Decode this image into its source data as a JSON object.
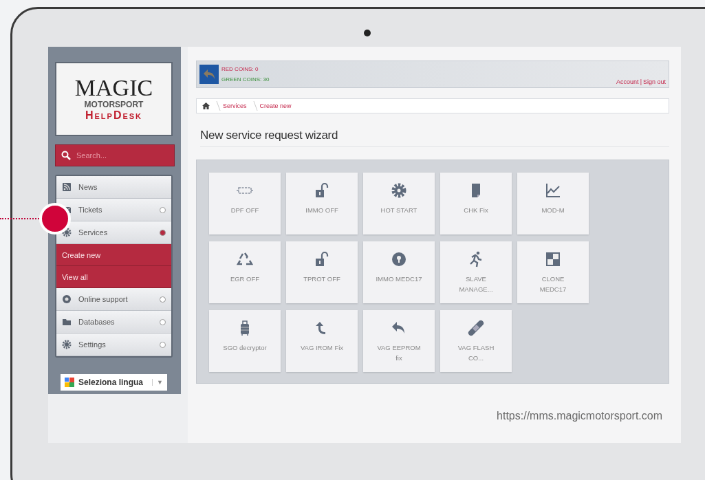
{
  "sidebar": {
    "logo": {
      "title": "MAGIC",
      "subtitle": "MOTORSPORT",
      "product": "HelpDesk"
    },
    "search": {
      "placeholder": "Search..."
    },
    "menu": [
      {
        "label": "News",
        "kind": "plain"
      },
      {
        "label": "Tickets",
        "kind": "expandable",
        "expanded": false
      },
      {
        "label": "Services",
        "kind": "expandable",
        "expanded": true,
        "children": [
          {
            "label": "Create new"
          },
          {
            "label": "View all"
          }
        ]
      },
      {
        "label": "Online support",
        "kind": "expandable",
        "expanded": false
      },
      {
        "label": "Databases",
        "kind": "expandable",
        "expanded": false
      },
      {
        "label": "Settings",
        "kind": "expandable",
        "expanded": false
      }
    ],
    "language": {
      "label": "Seleziona lingua",
      "caret": "▼"
    }
  },
  "topbar": {
    "red_coins": "RED COINS: 0",
    "green_coins": "GREEN COINS: 30",
    "account": "Account",
    "separator": "|",
    "sign_out": "Sign out"
  },
  "breadcrumb": [
    "Services",
    "Create new"
  ],
  "title": "New service request wizard",
  "tiles": [
    {
      "lines": [
        "DPF OFF"
      ]
    },
    {
      "lines": [
        "IMMO OFF"
      ]
    },
    {
      "lines": [
        "HOT START"
      ]
    },
    {
      "lines": [
        "CHK Fix"
      ]
    },
    {
      "lines": [
        "MOD-M"
      ]
    },
    {
      "lines": [
        "EGR OFF"
      ]
    },
    {
      "lines": [
        "TPROT OFF"
      ]
    },
    {
      "lines": [
        "IMMO MEDC17"
      ]
    },
    {
      "lines": [
        "SLAVE",
        "MANAGE..."
      ]
    },
    {
      "lines": [
        "CLONE",
        "MEDC17"
      ]
    },
    {
      "lines": [
        "SGO decryptor"
      ]
    },
    {
      "lines": [
        "VAG IROM Fix"
      ]
    },
    {
      "lines": [
        "VAG EEPROM",
        "fix"
      ]
    },
    {
      "lines": [
        "VAG FLASH",
        "CO..."
      ]
    }
  ],
  "caption": "https://mms.magicmotorsport.com"
}
